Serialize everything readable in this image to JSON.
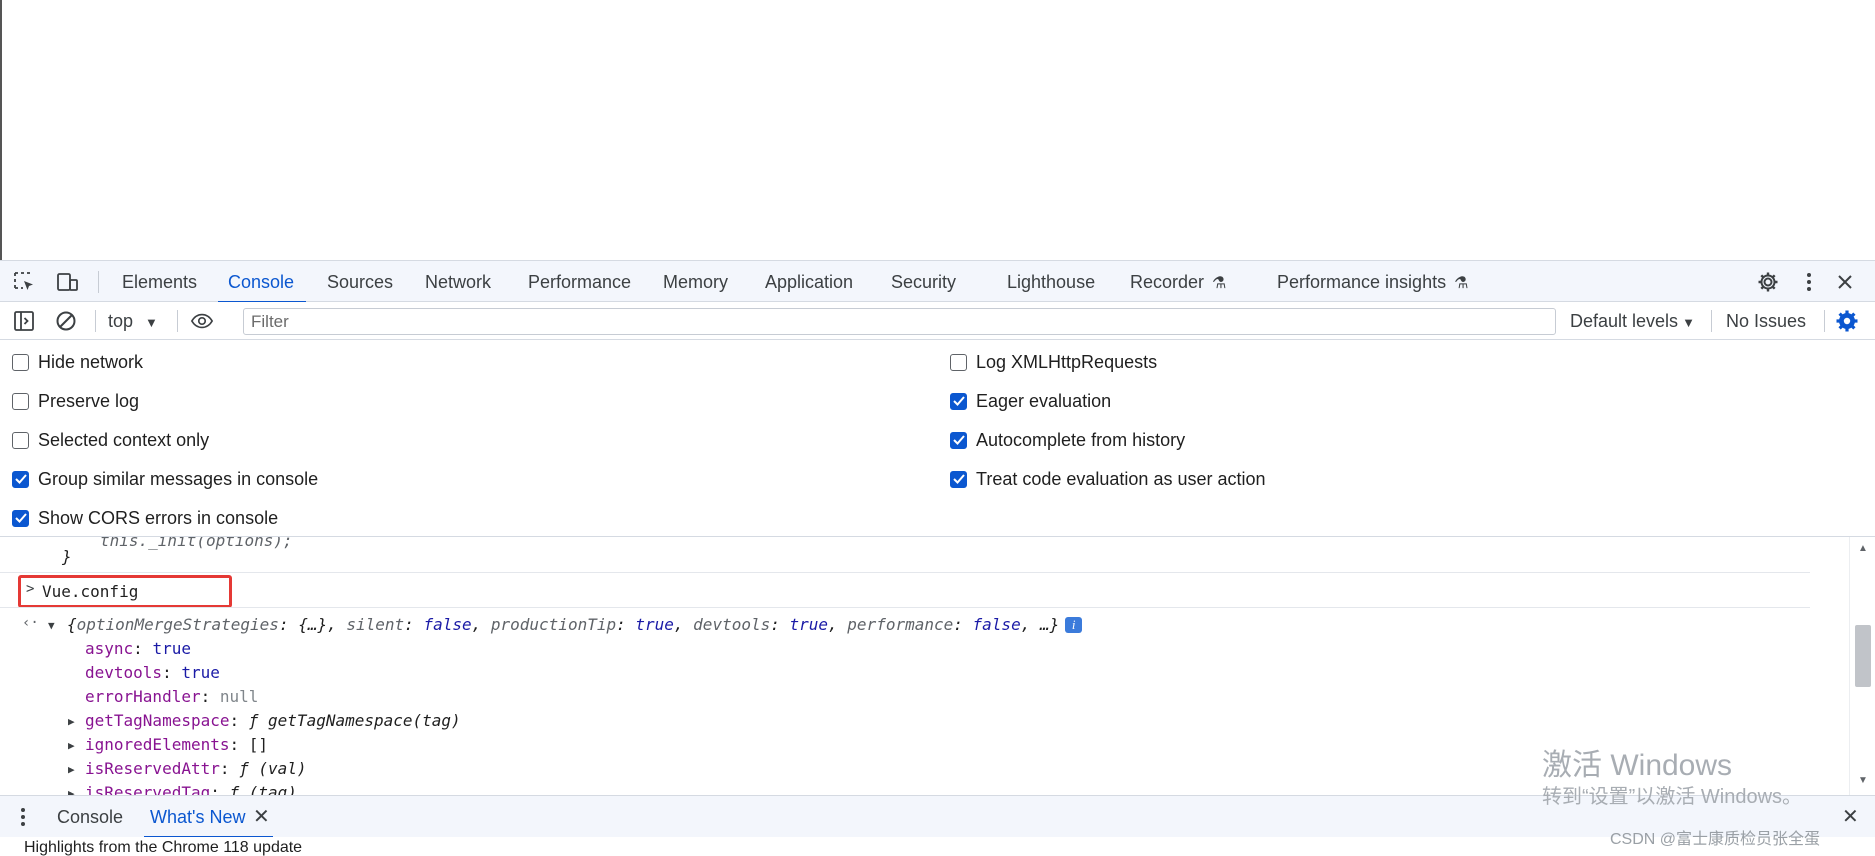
{
  "devtools": {
    "tabs": [
      "Elements",
      "Console",
      "Sources",
      "Network",
      "Performance",
      "Memory",
      "Application",
      "Security",
      "Lighthouse",
      "Recorder",
      "Performance insights"
    ],
    "active_tab": "Console",
    "icons": {
      "inspect": "inspect-element-icon",
      "device": "device-toolbar-icon",
      "settings": "gear-icon",
      "more": "kebab-menu-icon",
      "close": "close-icon"
    }
  },
  "console_toolbar": {
    "context": "top",
    "filter_placeholder": "Filter",
    "levels": "Default levels",
    "issues": "No Issues",
    "accent": "#0b57d0"
  },
  "settings": {
    "left": [
      {
        "label": "Hide network",
        "checked": false
      },
      {
        "label": "Preserve log",
        "checked": false
      },
      {
        "label": "Selected context only",
        "checked": false
      },
      {
        "label": "Group similar messages in console",
        "checked": true
      },
      {
        "label": "Show CORS errors in console",
        "checked": true
      }
    ],
    "right": [
      {
        "label": "Log XMLHttpRequests",
        "checked": false
      },
      {
        "label": "Eager evaluation",
        "checked": true
      },
      {
        "label": "Autocomplete from history",
        "checked": true
      },
      {
        "label": "Treat code evaluation as user action",
        "checked": true
      }
    ]
  },
  "console": {
    "prev_line": "this._init(options);",
    "prev_close": "}",
    "input": "Vue.config",
    "summary": {
      "open": "{",
      "k1": "optionMergeStrategies",
      "v1": "{…}",
      "k2": "silent",
      "v2": "false",
      "k3": "productionTip",
      "v3": "true",
      "k4": "devtools",
      "v4": "true",
      "k5": "performance",
      "v5": "false",
      "rest": "…}",
      "badge": "i"
    },
    "props": [
      {
        "key": "async",
        "value": "true",
        "expandable": false
      },
      {
        "key": "devtools",
        "value": "true",
        "expandable": false
      },
      {
        "key": "errorHandler",
        "value": "null",
        "expandable": false
      },
      {
        "key": "getTagNamespace",
        "value": "ƒ getTagNamespace(tag)",
        "expandable": true
      },
      {
        "key": "ignoredElements",
        "value": "[]",
        "expandable": true
      },
      {
        "key": "isReservedAttr",
        "value": "ƒ (val)",
        "expandable": true
      },
      {
        "key": "isReservedTag",
        "value": "ƒ (tag)",
        "expandable": true
      }
    ]
  },
  "drawer": {
    "tabs": [
      "Console",
      "What's New"
    ],
    "active": "What's New",
    "whats_new_text": "Highlights from the Chrome 118 update"
  },
  "watermark": {
    "line1": "激活 Windows",
    "line2": "转到“设置”以激活 Windows。",
    "csdn": "CSDN @富士康质检员张全蛋"
  }
}
